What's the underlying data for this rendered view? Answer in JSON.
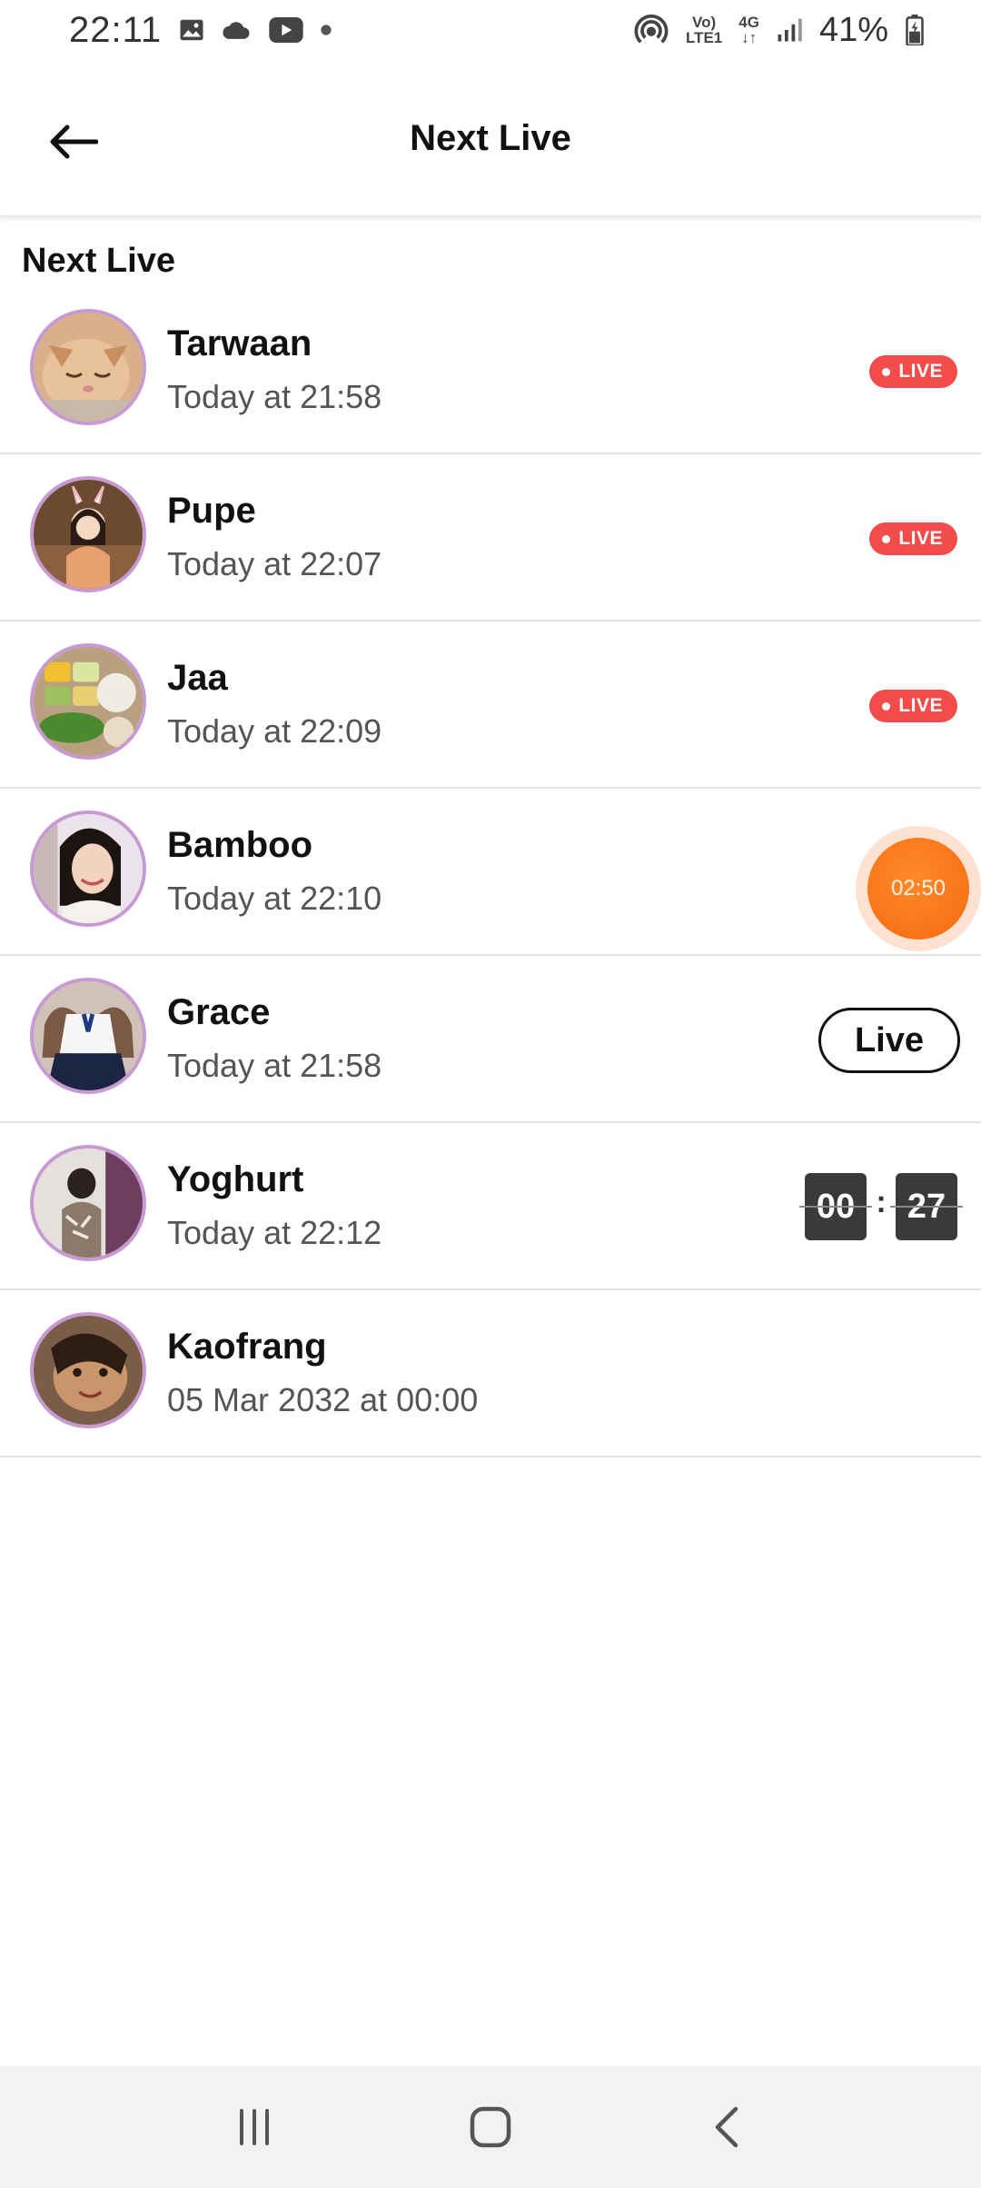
{
  "status_bar": {
    "time": "22:11",
    "network_label_top": "Vo)",
    "network_label_bottom": "LTE1",
    "network_type": "4G",
    "battery": "41%"
  },
  "app_bar": {
    "title": "Next Live"
  },
  "section": {
    "title": "Next Live"
  },
  "rows": [
    {
      "name": "Tarwaan",
      "time": "Today at 21:58",
      "status": "LIVE"
    },
    {
      "name": "Pupe",
      "time": "Today at 22:07",
      "status": "LIVE"
    },
    {
      "name": "Jaa",
      "time": "Today at 22:09",
      "status": "LIVE"
    },
    {
      "name": "Bamboo",
      "time": "Today at 22:10",
      "countdown": "02:50"
    },
    {
      "name": "Grace",
      "time": "Today at 21:58",
      "button": "Live"
    },
    {
      "name": "Yoghurt",
      "time": "Today at 22:12",
      "clock_min": "00",
      "clock_sep": ":",
      "clock_sec": "27"
    },
    {
      "name": "Kaofrang",
      "time": "05 Mar 2032 at 00:00"
    }
  ],
  "colors": {
    "live_badge": "#f44b4b",
    "countdown": "#f46a10",
    "avatar_ring": "#c79bd2"
  }
}
